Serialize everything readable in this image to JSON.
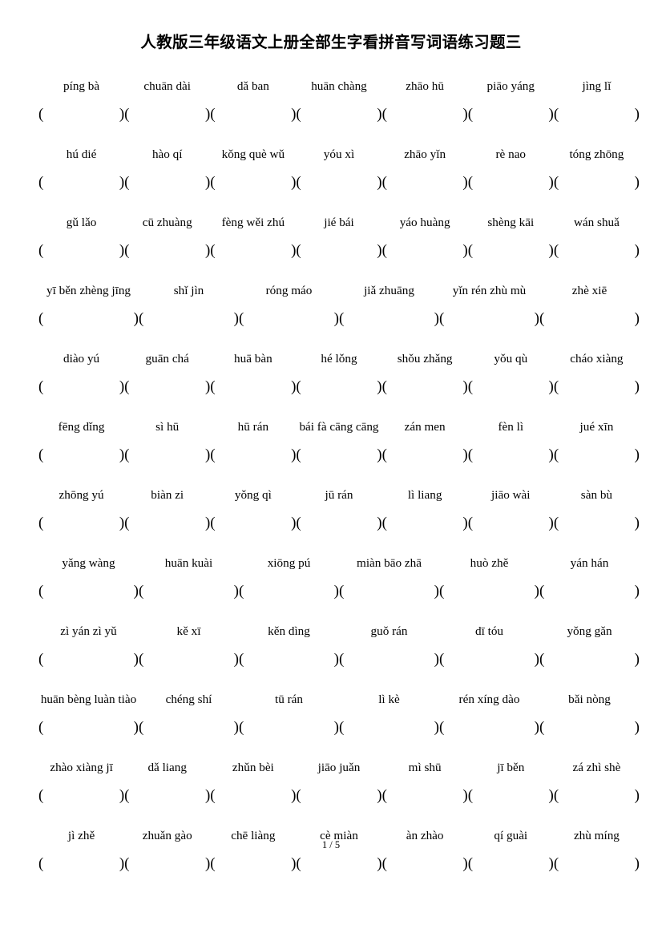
{
  "document": {
    "title": "人教版三年级语文上册全部生字看拼音写词语练习题三",
    "page_number": "1 / 5"
  },
  "rows": [
    {
      "id": "row-1",
      "items": [
        "píng bà",
        "chuān dài",
        "dǎ ban",
        "huān chàng",
        "zhāo hū",
        "piāo yáng",
        "jìng   lǐ"
      ],
      "blanks": 7
    },
    {
      "id": "row-2",
      "items": [
        "hú dié",
        "hào   qí",
        "kǒng què wǔ",
        "yóu xì",
        "zhāo yǐn",
        "rè nao",
        "tóng zhōng"
      ],
      "blanks": 7
    },
    {
      "id": "row-3",
      "items": [
        "gǔ lǎo",
        "cū zhuàng",
        "fèng wěi zhú",
        "jié bái",
        "yáo huàng",
        "shèng kāi",
        "wán shuǎ"
      ],
      "blanks": 7
    },
    {
      "id": "row-4",
      "items": [
        "yī  běn zhèng jīng",
        "shǐ jìn",
        "róng máo",
        "jiǎ zhuāng",
        "yǐn rén zhù mù",
        "zhè xiē"
      ],
      "blanks": 6
    },
    {
      "id": "row-5",
      "items": [
        "diào yú",
        "guān chá",
        "huā  bàn",
        "hé lǒng",
        "shǒu zhǎng",
        "yǒu   qù",
        "cháo xiàng"
      ],
      "blanks": 7
    },
    {
      "id": "row-6",
      "items": [
        "fēng dǐng",
        "sì   hū",
        "hū  rán",
        "bái fà cāng cāng",
        "zán men",
        "fèn   lì",
        "jué   xīn"
      ],
      "blanks": 7
    },
    {
      "id": "row-7",
      "items": [
        "zhōng yú",
        "biàn  zi",
        "yǒng  qì",
        "jū  rán",
        "lì  liang",
        "jiāo wài",
        "sàn bù"
      ],
      "blanks": 7
    },
    {
      "id": "row-8",
      "items": [
        "yǎng wàng",
        "huān kuài",
        "xiōng pú",
        "miàn bāo zhā",
        "huò zhě",
        "yán   hán"
      ],
      "blanks": 6
    },
    {
      "id": "row-9",
      "items": [
        "zì yán zì yǔ",
        "kě    xī",
        "kěn dìng",
        "guǒ rán",
        "dī  tóu",
        "yǒng gǎn"
      ],
      "blanks": 6
    },
    {
      "id": "row-10",
      "items": [
        "huān bèng luàn tiào",
        "chéng shí",
        "tū rán",
        "lì   kè",
        "rén  xíng dào",
        "bǎi nòng"
      ],
      "blanks": 6
    },
    {
      "id": "row-11",
      "items": [
        "zhào xiàng jī",
        "dǎ liang",
        "zhǔn bèi",
        "jiāo juǎn",
        "mì shū",
        "jī  běn",
        "zá zhì shè"
      ],
      "blanks": 7
    },
    {
      "id": "row-12",
      "items": [
        "jì zhě",
        "zhuǎn gào",
        "chē  liàng",
        "cè miàn",
        "àn   zhào",
        "qí guài",
        "zhù míng"
      ],
      "blanks": 7
    }
  ]
}
